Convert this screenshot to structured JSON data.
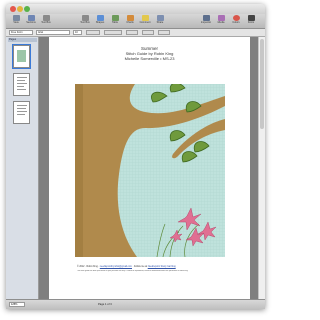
{
  "window": {
    "title": "Summer stitch guide MS-23.pages (Word Processing)"
  },
  "toolbar": {
    "left": [
      {
        "label": "View",
        "icon": "view-icon",
        "color": "#7a8aa0"
      },
      {
        "label": "Sections",
        "icon": "sections-icon",
        "color": "#6f86b4"
      },
      {
        "label": "Text Box",
        "icon": "textbox-icon",
        "color": "#8a8a8a"
      }
    ],
    "middle": [
      {
        "label": "Text Box",
        "icon": "textbox-icon",
        "color": "#8a8a8a"
      },
      {
        "label": "Shapes",
        "icon": "shapes-icon",
        "color": "#5c8fd6"
      },
      {
        "label": "Table",
        "icon": "table-icon",
        "color": "#6c9a5a"
      },
      {
        "label": "Charts",
        "icon": "charts-icon",
        "color": "#d38b3b"
      },
      {
        "label": "Comment",
        "icon": "comment-icon",
        "color": "#e2c84d"
      },
      {
        "label": "Share",
        "icon": "share-icon",
        "color": "#7d8fb0"
      }
    ],
    "right": [
      {
        "label": "Inspector",
        "icon": "inspector-icon",
        "color": "#5d6f8d"
      },
      {
        "label": "Media",
        "icon": "media-icon",
        "color": "#a96fb5"
      },
      {
        "label": "Colors",
        "icon": "colors-icon",
        "color": "#d9564b"
      },
      {
        "label": "Fonts",
        "icon": "fonts-icon",
        "color": "#444444"
      }
    ]
  },
  "format_bar": {
    "style": "Free Form",
    "font": "Arial",
    "size": "10"
  },
  "sidebar": {
    "header": "Pages"
  },
  "document": {
    "title": "Summer",
    "subtitle": "Stitch Guide by Robin King",
    "design_line": "Michelle Somerville • MS-23",
    "footer_copyright": "© 2012 · Robin King ·",
    "footer_email": "needlepointbyrobin@gmail.com",
    "footer_follow": "· Follow me at",
    "footer_blog": "Needlepoint Study Gal blog",
    "footer_fine_print": "This stitch guide has been purchased for your personal use only. It cannot be reproduced, shared or distributed without the permission of Robin King."
  },
  "status": {
    "zoom": "125%",
    "page_indicator": "Page 1 of 3"
  },
  "colors": {
    "sky": "#bfe2dc",
    "trunk": "#b08a4c",
    "leaf": "#6f9a3c",
    "flower": "#e06f92"
  }
}
